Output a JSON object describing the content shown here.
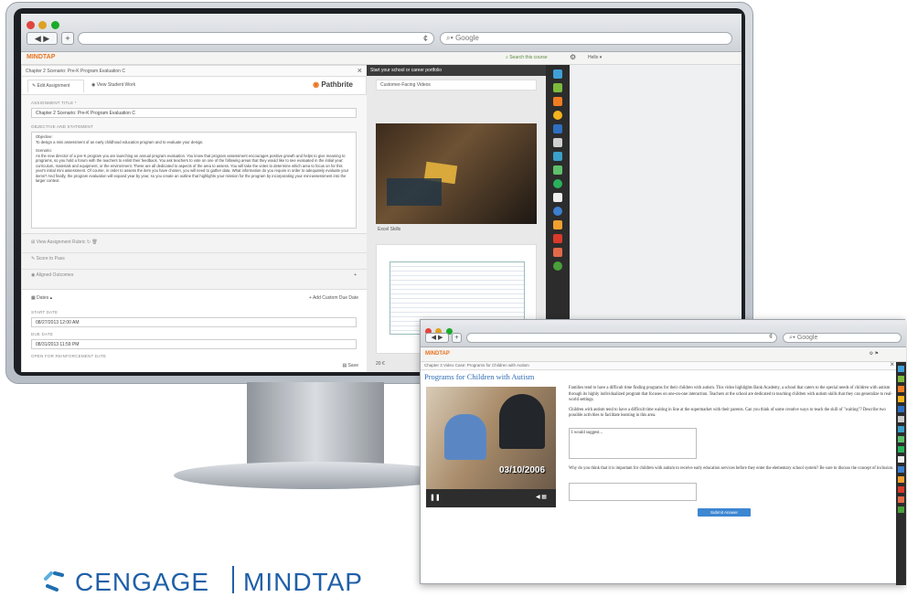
{
  "monitor": {
    "browser": {
      "search_placeholder": "Google",
      "reload_glyph": "¢"
    },
    "app": {
      "logo_text": "MINDTAP",
      "logo_sub": "from Cengage",
      "search_course": "Search this course",
      "user": "Hello ▾"
    },
    "activity": {
      "title": "Chapter 2 Scenario: Pre-K Program Evaluation C",
      "tabs": [
        "Edit Assignment",
        "View Student Work"
      ],
      "pathbrite": "Pathbrite",
      "assignment_title_label": "ASSIGNMENT TITLE *",
      "assignment_title_value": "Chapter 2 Scenario: Pre-K Program Evaluation C",
      "objective_label": "OBJECTIVE AND STATEMENT",
      "objective_heading": "Objective:",
      "objective_text": "To design a mini assessment of an early childhood education program and to evaluate your design.",
      "scenario_heading": "Scenario:",
      "scenario_text": "As the new director of a pre-K program you are launching an annual program evaluation. You know that program assessment encourages positive growth and helps to give meaning to programs, so you hold a forum with the teachers to enlist their feedback. You ask teachers to vote on one of the following areas that they would like to see evaluated in the initial year: curriculum, materials and equipment, or the environment. These are all dedicated to aspects of the area to assess. You will take the votes to determine which area to focus on for this year's initial mini assessment. Of course, in order to assess the item you have chosen, you will need to gather data. What information do you require in order to adequately evaluate your items? And finally, the program evaluation will expand year by year, so you create an outline that highlights your mission for the program by incorporating your mini-assessment into the larger context.",
      "rubric": "View Assignment Rubric",
      "score_to_pass": "Score to Pass",
      "aligned_outcomes": "Aligned Outcomes",
      "dates": "Dates ▴",
      "add_custom_due": "+ Add Custom Due Date",
      "start_date_label": "START DATE",
      "start_date": "08/27/2013 12:00 AM",
      "due_date_label": "DUE DATE",
      "due_date": "08/31/2013 11:59 PM",
      "open_for_reinforcement": "OPEN FOR REINFORCEMENT DATE",
      "save": "Save"
    },
    "portfolio": {
      "title": "Start your school or career portfolio",
      "item1": "Customer-Facing Videos",
      "item2": "Excel Skills",
      "footer": "20 €"
    }
  },
  "window2": {
    "search_placeholder": "Google",
    "reload_glyph": "¢",
    "logo_text": "MINDTAP",
    "breadcrumb": "Chapter 3 Video Case: Programs for Children with Autism",
    "page_title": "Programs for Children with Autism",
    "video_timestamp": "03/10/2006",
    "para1": "Families tend to have a difficult time finding programs for their children with autism. This video highlights Bank Academy, a school that caters to the special needs of children with autism through its highly individualized program that focuses on one-on-one interaction. Teachers at the school are dedicated to teaching children with autism skills that they can generalize to real-world settings.",
    "para2": "Children with autism tend to have a difficult time waiting in line at the supermarket with their parents. Can you think of some creative ways to teach the skill of \"waiting\"? Describe two possible activities to facilitate learning in this area.",
    "answer1": "I would suggest...",
    "para3": "Why do you think that it is important for children with autism to receive early education services before they enter the elementary school system? Be sure to discuss the concept of inclusion.",
    "submit": "Submit Answer"
  },
  "brand": {
    "left": "CENGAGE",
    "right": "MINDTAP"
  },
  "colors": {
    "accent_orange": "#e8731f",
    "title_blue": "#2f6db5",
    "submit_blue": "#3d86d1",
    "rail_dark": "#2c2c2c"
  }
}
